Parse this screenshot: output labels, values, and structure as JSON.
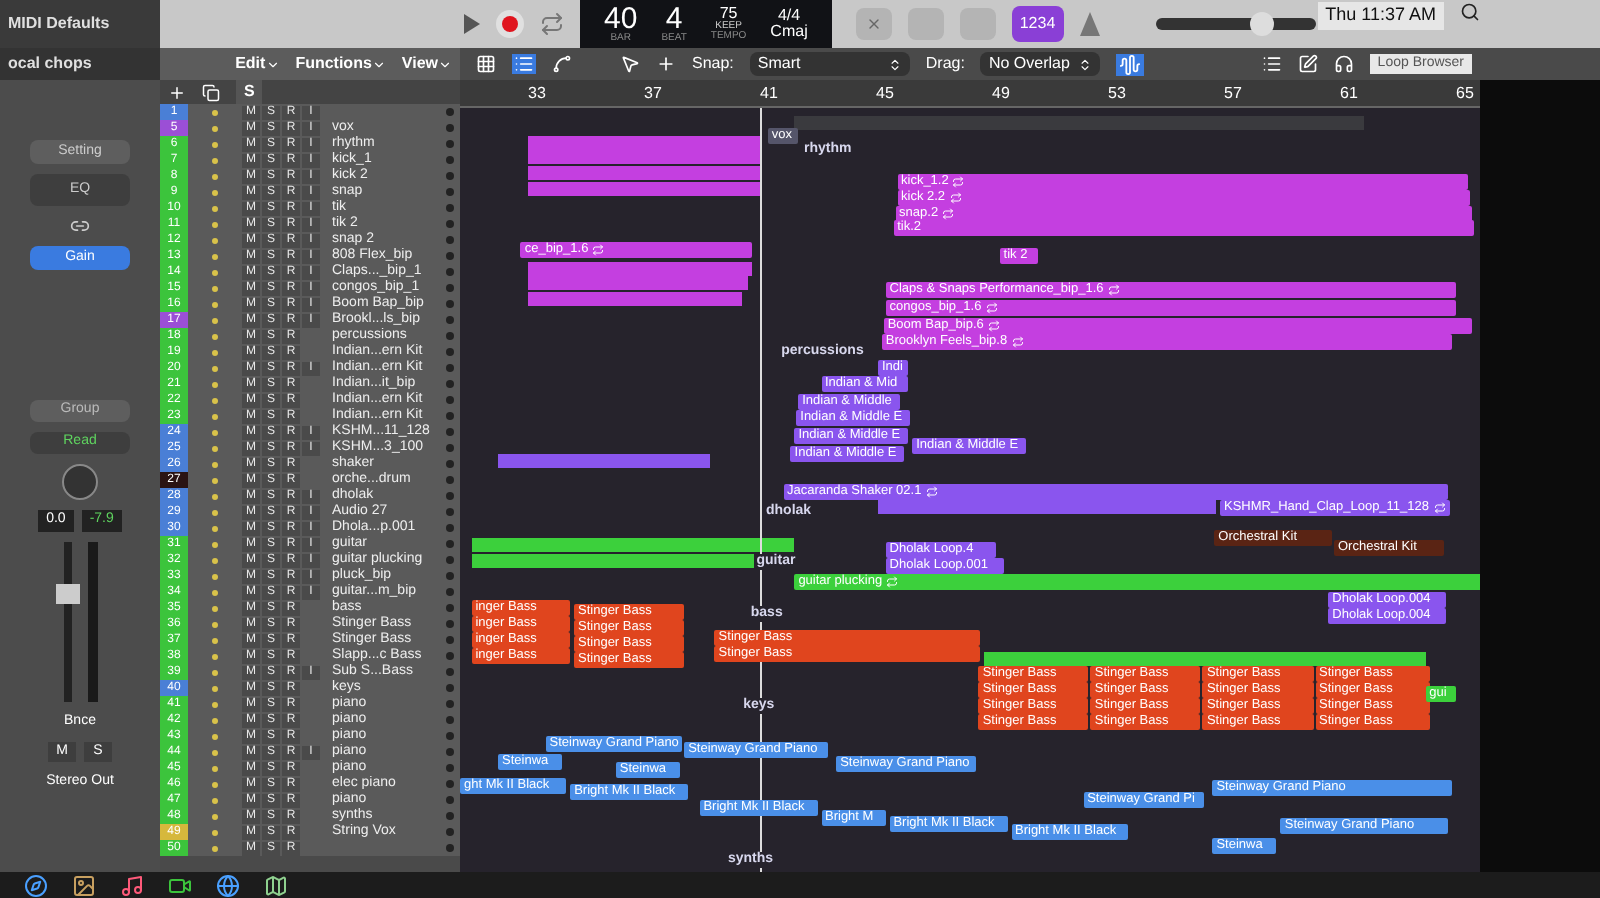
{
  "menubar": {
    "time": "Thu 11:37 AM"
  },
  "inspector": {
    "title": "MIDI Defaults",
    "region": "ocal chops",
    "setting": "Setting",
    "eq": "EQ",
    "gain": "Gain",
    "group": "Group",
    "automation": "Read",
    "pan_value": "0.0",
    "volume_value": "-7.9",
    "fader": {
      "level": 0.7
    },
    "bounce": "Bnce",
    "mute": "M",
    "solo": "S",
    "output": "Stereo Out"
  },
  "menus": [
    "Edit",
    "Functions",
    "View"
  ],
  "track_header": {
    "solo": "S"
  },
  "lcd": {
    "bar": "40",
    "beat": "4",
    "bar_label": "BAR",
    "beat_label": "BEAT",
    "tempo": "75",
    "tempo_mode": "KEEP",
    "tempo_label": "TEMPO",
    "signature": "4/4",
    "key": "Cmaj"
  },
  "count_in": {
    "label": "1234",
    "on": true
  },
  "zoom_slider": {
    "level": 0.7
  },
  "snap": {
    "label": "Snap:",
    "value": "Smart"
  },
  "drag": {
    "label": "Drag:",
    "value": "No Overlap"
  },
  "tooltip": "Loop Browser",
  "ruler": [
    "33",
    "37",
    "41",
    "45",
    "49",
    "53",
    "57",
    "61",
    "65"
  ],
  "tracks": [
    {
      "number": "1",
      "color": "#4a7fd6",
      "buttons": [
        "M",
        "S",
        "R",
        "I"
      ]
    },
    {
      "number": "5",
      "color": "#9b4fd6",
      "name": "vox",
      "buttons": [
        "M",
        "S",
        "R",
        "I"
      ]
    },
    {
      "number": "6",
      "color": "#3cc43c",
      "name": "rhythm",
      "buttons": [
        "M",
        "S",
        "R",
        "I"
      ]
    },
    {
      "number": "7",
      "color": "#3cc43c",
      "name": "kick_1",
      "buttons": [
        "M",
        "S",
        "R",
        "I"
      ]
    },
    {
      "number": "8",
      "color": "#3cc43c",
      "name": "kick 2",
      "buttons": [
        "M",
        "S",
        "R",
        "I"
      ]
    },
    {
      "number": "9",
      "color": "#3cc43c",
      "name": "snap",
      "buttons": [
        "M",
        "S",
        "R",
        "I"
      ]
    },
    {
      "number": "10",
      "color": "#3cc43c",
      "name": "tik",
      "buttons": [
        "M",
        "S",
        "R",
        "I"
      ]
    },
    {
      "number": "11",
      "color": "#3cc43c",
      "name": "tik 2",
      "buttons": [
        "M",
        "S",
        "R",
        "I"
      ]
    },
    {
      "number": "12",
      "color": "#3cc43c",
      "name": "snap 2",
      "buttons": [
        "M",
        "S",
        "R",
        "I"
      ]
    },
    {
      "number": "13",
      "color": "#3cc43c",
      "name": "808 Flex_bip",
      "buttons": [
        "M",
        "S",
        "R",
        "I"
      ]
    },
    {
      "number": "14",
      "color": "#3cc43c",
      "name": "Claps..._bip_1",
      "buttons": [
        "M",
        "S",
        "R",
        "I"
      ]
    },
    {
      "number": "15",
      "color": "#3cc43c",
      "name": "congos_bip_1",
      "buttons": [
        "M",
        "S",
        "R",
        "I"
      ]
    },
    {
      "number": "16",
      "color": "#3cc43c",
      "name": "Boom Bap_bip",
      "buttons": [
        "M",
        "S",
        "R",
        "I"
      ]
    },
    {
      "number": "17",
      "color": "#9b4fd6",
      "name": "Brookl...ls_bip",
      "buttons": [
        "M",
        "S",
        "R",
        "I"
      ]
    },
    {
      "number": "18",
      "color": "#3cc43c",
      "name": "percussions",
      "buttons": [
        "M",
        "S",
        "R"
      ]
    },
    {
      "number": "19",
      "color": "#3cc43c",
      "name": "Indian...ern Kit",
      "buttons": [
        "M",
        "S",
        "R"
      ]
    },
    {
      "number": "20",
      "color": "#3cc43c",
      "name": "Indian...ern Kit",
      "buttons": [
        "M",
        "S",
        "R",
        "I"
      ]
    },
    {
      "number": "21",
      "color": "#3cc43c",
      "name": "Indian...it_bip",
      "buttons": [
        "M",
        "S",
        "R"
      ]
    },
    {
      "number": "22",
      "color": "#3cc43c",
      "name": "Indian...ern Kit",
      "buttons": [
        "M",
        "S",
        "R"
      ]
    },
    {
      "number": "23",
      "color": "#3cc43c",
      "name": "Indian...ern Kit",
      "buttons": [
        "M",
        "S",
        "R"
      ]
    },
    {
      "number": "24",
      "color": "#4a7fd6",
      "name": "KSHM...11_128",
      "buttons": [
        "M",
        "S",
        "R",
        "I"
      ]
    },
    {
      "number": "25",
      "color": "#4a7fd6",
      "name": "KSHM...3_100",
      "buttons": [
        "M",
        "S",
        "R",
        "I"
      ]
    },
    {
      "number": "26",
      "color": "#4a7fd6",
      "name": "shaker",
      "buttons": [
        "M",
        "S",
        "R"
      ]
    },
    {
      "number": "27",
      "color": "#2a1414",
      "name": "orche...drum",
      "buttons": [
        "M",
        "S",
        "R"
      ]
    },
    {
      "number": "28",
      "color": "#4a7fd6",
      "name": "dholak",
      "buttons": [
        "M",
        "S",
        "R",
        "I"
      ]
    },
    {
      "number": "29",
      "color": "#4a7fd6",
      "name": "Audio 27",
      "buttons": [
        "M",
        "S",
        "R",
        "I"
      ]
    },
    {
      "number": "30",
      "color": "#4a7fd6",
      "name": "Dhola...p.001",
      "buttons": [
        "M",
        "S",
        "R",
        "I"
      ]
    },
    {
      "number": "31",
      "color": "#3cc43c",
      "name": "guitar",
      "buttons": [
        "M",
        "S",
        "R",
        "I"
      ]
    },
    {
      "number": "32",
      "color": "#3cc43c",
      "name": "guitar plucking",
      "buttons": [
        "M",
        "S",
        "R",
        "I"
      ]
    },
    {
      "number": "33",
      "color": "#3cc43c",
      "name": "pluck_bip",
      "buttons": [
        "M",
        "S",
        "R",
        "I"
      ]
    },
    {
      "number": "34",
      "color": "#3cc43c",
      "name": "guitar...m_bip",
      "buttons": [
        "M",
        "S",
        "R",
        "I"
      ]
    },
    {
      "number": "35",
      "color": "#3cc43c",
      "name": "bass",
      "buttons": [
        "M",
        "S",
        "R"
      ]
    },
    {
      "number": "36",
      "color": "#3cc43c",
      "name": "Stinger Bass",
      "buttons": [
        "M",
        "S",
        "R"
      ]
    },
    {
      "number": "37",
      "color": "#3cc43c",
      "name": "Stinger Bass",
      "buttons": [
        "M",
        "S",
        "R"
      ]
    },
    {
      "number": "38",
      "color": "#3cc43c",
      "name": "Slapp...c Bass",
      "buttons": [
        "M",
        "S",
        "R"
      ]
    },
    {
      "number": "39",
      "color": "#3cc43c",
      "name": "Sub S...Bass",
      "buttons": [
        "M",
        "S",
        "R",
        "I"
      ]
    },
    {
      "number": "40",
      "color": "#4a7fd6",
      "name": "keys",
      "buttons": [
        "M",
        "S",
        "R"
      ]
    },
    {
      "number": "41",
      "color": "#3cc43c",
      "name": "piano",
      "buttons": [
        "M",
        "S",
        "R"
      ]
    },
    {
      "number": "42",
      "color": "#3cc43c",
      "name": "piano",
      "buttons": [
        "M",
        "S",
        "R"
      ]
    },
    {
      "number": "43",
      "color": "#3cc43c",
      "name": "piano",
      "buttons": [
        "M",
        "S",
        "R"
      ]
    },
    {
      "number": "44",
      "color": "#3cc43c",
      "name": "piano",
      "buttons": [
        "M",
        "S",
        "R",
        "I"
      ]
    },
    {
      "number": "45",
      "color": "#3cc43c",
      "name": "piano",
      "buttons": [
        "M",
        "S",
        "R"
      ]
    },
    {
      "number": "46",
      "color": "#3cc43c",
      "name": "elec piano",
      "buttons": [
        "M",
        "S",
        "R"
      ]
    },
    {
      "number": "47",
      "color": "#3cc43c",
      "name": "piano",
      "buttons": [
        "M",
        "S",
        "R"
      ]
    },
    {
      "number": "48",
      "color": "#3cc43c",
      "name": "synths",
      "buttons": [
        "M",
        "S",
        "R"
      ]
    },
    {
      "number": "49",
      "color": "#d6b83c",
      "name": "String Vox",
      "buttons": [
        "M",
        "S",
        "R"
      ]
    },
    {
      "number": "50",
      "color": "#3cc43c",
      "buttons": [
        "M",
        "S",
        "R"
      ]
    }
  ],
  "regions": [
    {
      "kind": "region",
      "name": "vox",
      "color": "#55556a",
      "loop": false
    },
    {
      "kind": "folder",
      "name": "rhythm"
    },
    {
      "kind": "region",
      "name": "kick_1.2",
      "color": "#c43fe0",
      "loop": true
    },
    {
      "kind": "region",
      "name": "kick 2.2",
      "color": "#c43fe0",
      "loop": true
    },
    {
      "kind": "region",
      "name": "snap.2",
      "color": "#c43fe0",
      "loop": true
    },
    {
      "kind": "region",
      "name": "tik.2",
      "color": "#c43fe0",
      "loop": false
    },
    {
      "kind": "region",
      "name": "ce_bip_1.6",
      "color": "#c43fe0",
      "loop": true
    },
    {
      "kind": "region",
      "name": "tik 2",
      "color": "#c43fe0",
      "loop": false
    },
    {
      "kind": "region",
      "name": "Claps & Snaps Performance_bip_1.6",
      "color": "#c43fe0",
      "loop": true
    },
    {
      "kind": "region",
      "name": "congos_bip_1.6",
      "color": "#c43fe0",
      "loop": true
    },
    {
      "kind": "region",
      "name": "Boom Bap_bip.6",
      "color": "#c43fe0",
      "loop": true
    },
    {
      "kind": "region",
      "name": "Brooklyn Feels_bip.8",
      "color": "#c43fe0",
      "loop": true
    },
    {
      "kind": "folder",
      "name": "percussions"
    },
    {
      "kind": "region",
      "name": "Indi",
      "color": "#8a55ee",
      "loop": false
    },
    {
      "kind": "region",
      "name": "Indian & Mid",
      "color": "#8a55ee",
      "loop": false
    },
    {
      "kind": "region",
      "name": "Indian & Middle",
      "color": "#8a55ee",
      "loop": false
    },
    {
      "kind": "region",
      "name": "Indian & Middle E",
      "color": "#8a55ee",
      "loop": false
    },
    {
      "kind": "region",
      "name": "Indian & Middle E",
      "color": "#8a55ee",
      "loop": false
    },
    {
      "kind": "region",
      "name": "Indian & Middle E",
      "color": "#8a55ee",
      "loop": false
    },
    {
      "kind": "region",
      "name": "Indian & Middle E",
      "color": "#8a55ee",
      "loop": false
    },
    {
      "kind": "region",
      "name": "Jacaranda Shaker 02.1",
      "color": "#8a55ee",
      "loop": true
    },
    {
      "kind": "folder",
      "name": "dholak"
    },
    {
      "kind": "region",
      "name": "KSHMR_Hand_Clap_Loop_11_128",
      "color": "#8a55ee",
      "loop": true
    },
    {
      "kind": "region",
      "name": "Dholak Loop.4",
      "color": "#8a55ee",
      "loop": false
    },
    {
      "kind": "region",
      "name": "Dholak Loop.001",
      "color": "#8a55ee",
      "loop": false
    },
    {
      "kind": "region",
      "name": "Orchestral Kit",
      "color": "#5a2414",
      "loop": false
    },
    {
      "kind": "region",
      "name": "Orchestral Kit",
      "color": "#5a2414",
      "loop": false
    },
    {
      "kind": "folder",
      "name": "guitar"
    },
    {
      "kind": "region",
      "name": "guitar plucking",
      "color": "#3cd03c",
      "loop": true
    },
    {
      "kind": "folder",
      "name": "bass"
    },
    {
      "kind": "region",
      "name": "Dholak Loop.004",
      "color": "#8a55ee",
      "loop": false
    },
    {
      "kind": "region",
      "name": "Dholak Loop.004",
      "color": "#8a55ee",
      "loop": false
    },
    {
      "kind": "region",
      "name": "inger Bass",
      "color": "#e0451e",
      "loop": false
    },
    {
      "kind": "region",
      "name": "inger Bass",
      "color": "#e0451e",
      "loop": false
    },
    {
      "kind": "region",
      "name": "inger Bass",
      "color": "#e0451e",
      "loop": false
    },
    {
      "kind": "region",
      "name": "inger Bass",
      "color": "#e0451e",
      "loop": false
    },
    {
      "kind": "region",
      "name": "Stinger Bass",
      "color": "#e0451e",
      "loop": false
    },
    {
      "kind": "region",
      "name": "Stinger Bass",
      "color": "#e0451e",
      "loop": false
    },
    {
      "kind": "region",
      "name": "Stinger Bass",
      "color": "#e0451e",
      "loop": false
    },
    {
      "kind": "region",
      "name": "Stinger Bass",
      "color": "#e0451e",
      "loop": false
    },
    {
      "kind": "region",
      "name": "Stinger Bass",
      "color": "#e0451e",
      "loop": false
    },
    {
      "kind": "region",
      "name": "Stinger Bass",
      "color": "#e0451e",
      "loop": false
    },
    {
      "kind": "region",
      "name": "Stinger Bass",
      "color": "#e0451e",
      "loop": false
    },
    {
      "kind": "region",
      "name": "Stinger Bass",
      "color": "#e0451e",
      "loop": false
    },
    {
      "kind": "region",
      "name": "Stinger Bass",
      "color": "#e0451e",
      "loop": false
    },
    {
      "kind": "region",
      "name": "Stinger Bass",
      "color": "#e0451e",
      "loop": false
    },
    {
      "kind": "region",
      "name": "Stinger Bass",
      "color": "#e0451e",
      "loop": false
    },
    {
      "kind": "region",
      "name": "Stinger Bass",
      "color": "#e0451e",
      "loop": false
    },
    {
      "kind": "region",
      "name": "Stinger Bass",
      "color": "#e0451e",
      "loop": false
    },
    {
      "kind": "region",
      "name": "Stinger Bass",
      "color": "#e0451e",
      "loop": false
    },
    {
      "kind": "region",
      "name": "Stinger Bass",
      "color": "#e0451e",
      "loop": false
    },
    {
      "kind": "region",
      "name": "Stinger Bass",
      "color": "#e0451e",
      "loop": false
    },
    {
      "kind": "region",
      "name": "Stinger Bass",
      "color": "#e0451e",
      "loop": false
    },
    {
      "kind": "region",
      "name": "Stinger Bass",
      "color": "#e0451e",
      "loop": false
    },
    {
      "kind": "region",
      "name": "Stinger Bass",
      "color": "#e0451e",
      "loop": false
    },
    {
      "kind": "region",
      "name": "Stinger Bass",
      "color": "#e0451e",
      "loop": false
    },
    {
      "kind": "region",
      "name": "Stinger Bass",
      "color": "#e0451e",
      "loop": false
    },
    {
      "kind": "region",
      "name": "Stinger Bass",
      "color": "#e0451e",
      "loop": false
    },
    {
      "kind": "folder",
      "name": "keys"
    },
    {
      "kind": "region",
      "name": "gui",
      "color": "#3cd03c",
      "loop": false
    },
    {
      "kind": "region",
      "name": "Steinway Grand Piano",
      "color": "#4a8fe8",
      "loop": false
    },
    {
      "kind": "region",
      "name": "Steinwa",
      "color": "#4a8fe8",
      "loop": false
    },
    {
      "kind": "region",
      "name": "Steinway Grand Piano",
      "color": "#4a8fe8",
      "loop": false
    },
    {
      "kind": "region",
      "name": "Steinwa",
      "color": "#4a8fe8",
      "loop": false
    },
    {
      "kind": "region",
      "name": "Steinway Grand Piano",
      "color": "#4a8fe8",
      "loop": false
    },
    {
      "kind": "region",
      "name": "ght Mk II Black",
      "color": "#4a8fe8",
      "loop": false
    },
    {
      "kind": "region",
      "name": "Bright Mk II Black",
      "color": "#4a8fe8",
      "loop": false
    },
    {
      "kind": "region",
      "name": "Steinway Grand Pi",
      "color": "#4a8fe8",
      "loop": false
    },
    {
      "kind": "region",
      "name": "Steinway Grand Piano",
      "color": "#4a8fe8",
      "loop": false
    },
    {
      "kind": "region",
      "name": "Bright Mk II Black",
      "color": "#4a8fe8",
      "loop": false
    },
    {
      "kind": "region",
      "name": "Bright M",
      "color": "#4a8fe8",
      "loop": false
    },
    {
      "kind": "region",
      "name": "Bright Mk II Black",
      "color": "#4a8fe8",
      "loop": false
    },
    {
      "kind": "region",
      "name": "Bright Mk II Black",
      "color": "#4a8fe8",
      "loop": false
    },
    {
      "kind": "region",
      "name": "Steinway Grand Piano",
      "color": "#4a8fe8",
      "loop": false
    },
    {
      "kind": "region",
      "name": "Steinwa",
      "color": "#4a8fe8",
      "loop": false
    },
    {
      "kind": "folder",
      "name": "synths"
    }
  ]
}
